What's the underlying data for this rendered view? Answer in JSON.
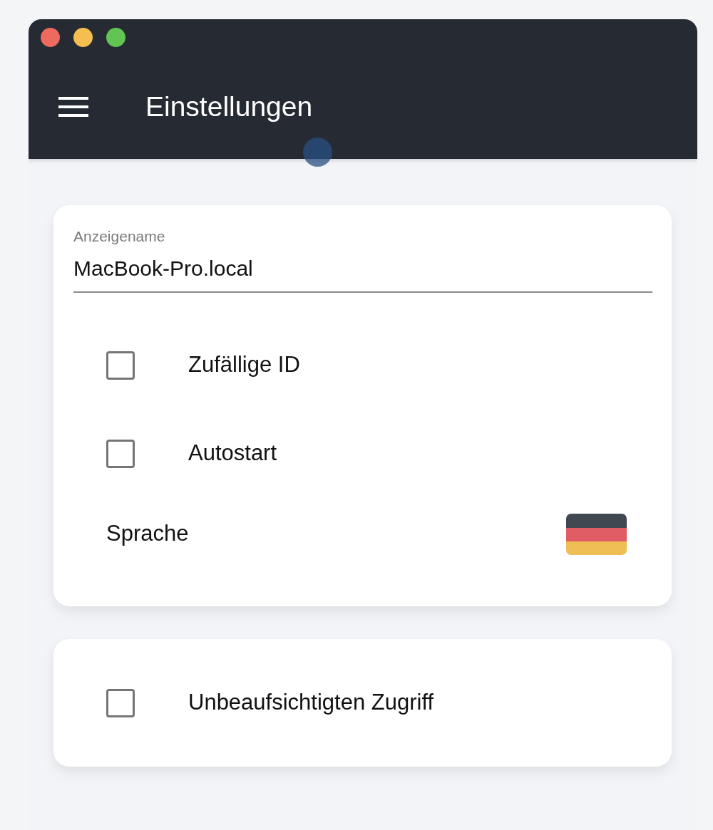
{
  "window": {
    "title": "Einstellungen"
  },
  "card_1": {
    "field": {
      "label": "Anzeigename",
      "value": "MacBook-Pro.local"
    },
    "options": [
      {
        "label": "Zufällige ID",
        "checked": false
      },
      {
        "label": "Autostart",
        "checked": false
      }
    ],
    "language": {
      "label": "Sprache"
    }
  },
  "card_2": {
    "options": [
      {
        "label": "Unbeaufsichtigten Zugriff",
        "checked": false
      }
    ]
  }
}
